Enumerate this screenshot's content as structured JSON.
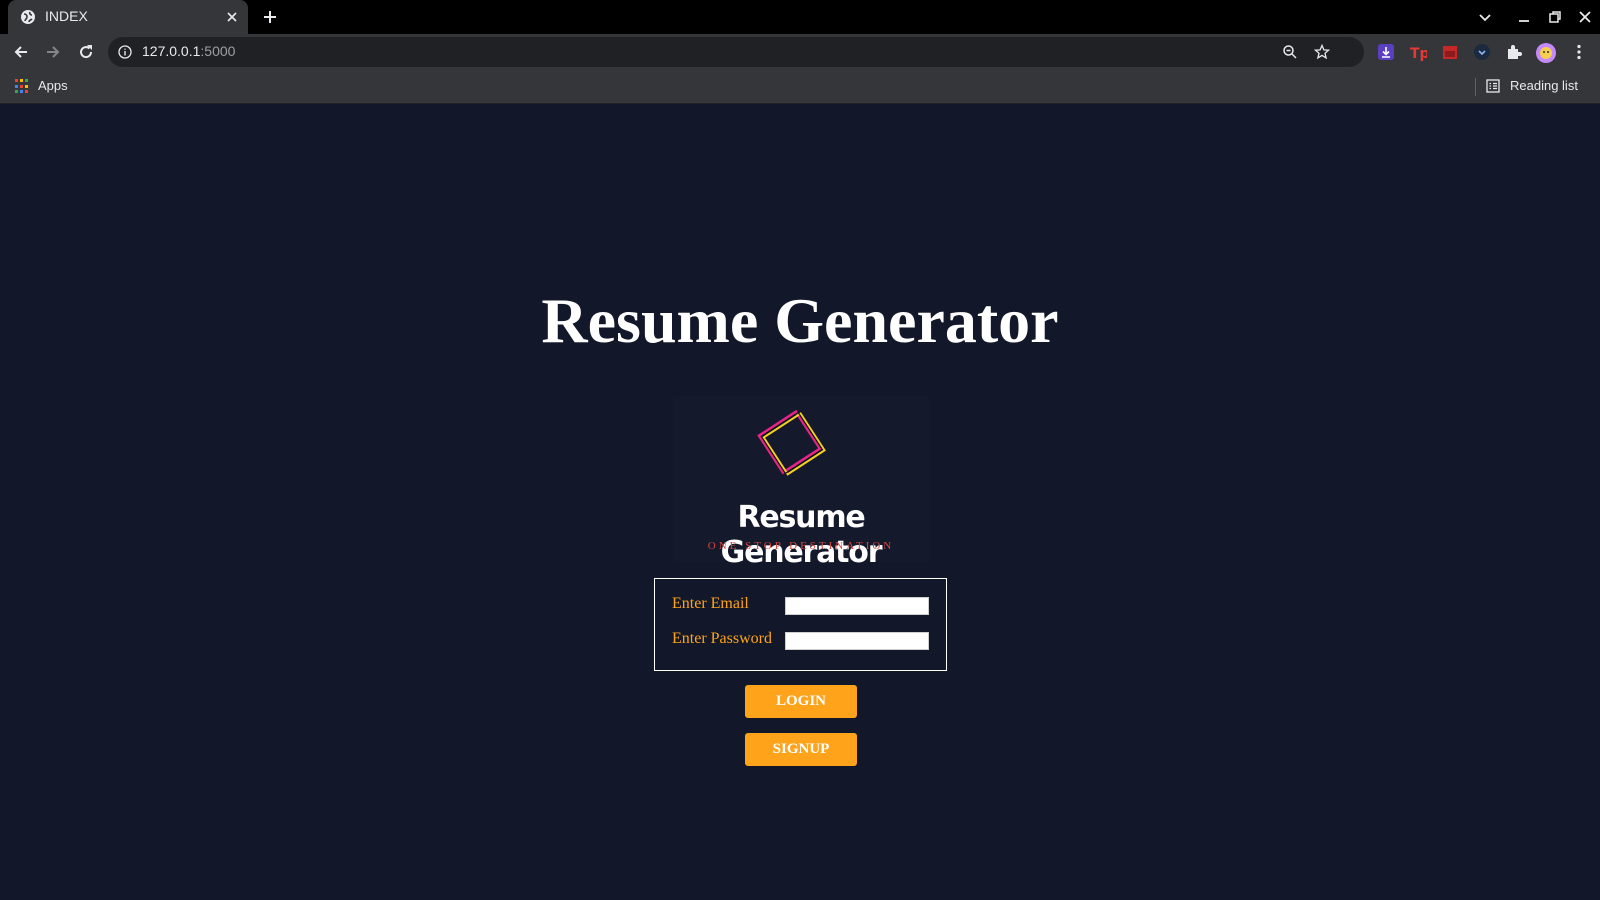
{
  "browser": {
    "tab": {
      "title": "INDEX"
    },
    "address": {
      "host": "127.0.0.1",
      "port": ":5000"
    },
    "bookmarks": {
      "apps_label": "Apps",
      "reading_list_label": "Reading list"
    }
  },
  "page": {
    "heading": "Resume Generator",
    "logo": {
      "title": "Resume Generator",
      "tagline": "ONE STOP DESTINATION"
    },
    "form": {
      "email_label": "Enter Email",
      "email_value": "",
      "password_label": "Enter Password",
      "password_value": ""
    },
    "buttons": {
      "login": "LOGIN",
      "signup": "SIGNUP"
    }
  },
  "colors": {
    "page_bg": "#121829",
    "accent_orange": "#ffa31a",
    "tagline_red": "#d8453f",
    "logo_pink": "#e5248a",
    "logo_yellow": "#f5d020"
  },
  "icons": [
    "globe-icon",
    "close-icon",
    "plus-icon",
    "chevron-down-icon",
    "minimize-icon",
    "restore-icon",
    "back-arrow-icon",
    "forward-arrow-icon",
    "reload-icon",
    "info-icon",
    "zoom-out-icon",
    "star-icon",
    "puzzle-icon",
    "profile-avatar-icon",
    "kebab-menu-icon",
    "apps-grid-icon",
    "reading-list-icon"
  ]
}
